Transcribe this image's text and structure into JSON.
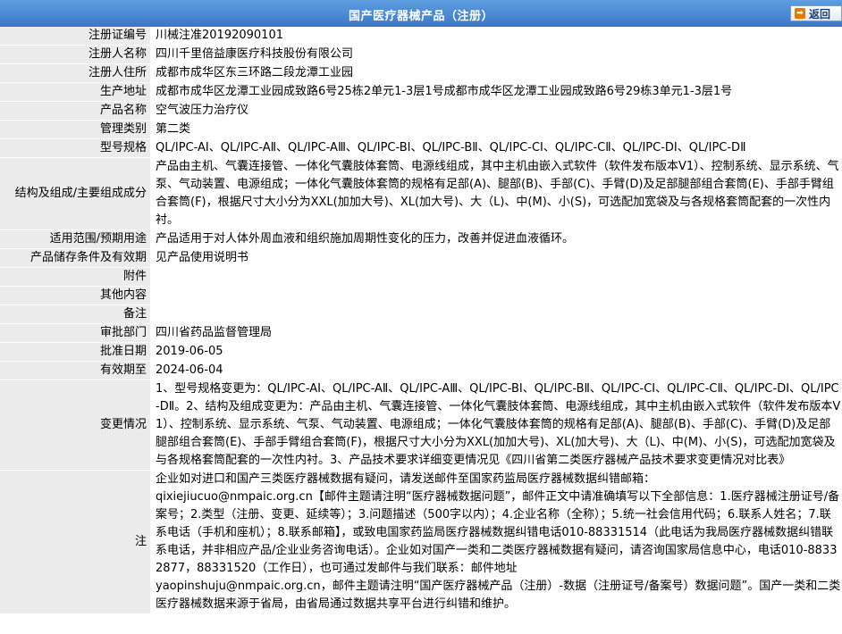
{
  "header": {
    "title": "国产医疗器械产品（注册）",
    "back_label": "返回"
  },
  "fields": {
    "reg_no": {
      "label": "注册证编号",
      "value": "川械注准20192090101"
    },
    "registrant": {
      "label": "注册人名称",
      "value": "四川千里倍益康医疗科技股份有限公司"
    },
    "address": {
      "label": "注册人住所",
      "value": "成都市成华区东三环路二段龙潭工业园"
    },
    "production": {
      "label": "生产地址",
      "value": "成都市成华区龙潭工业园成致路6号25栋2单元1-3层1号成都市成华区龙潭工业园成致路6号29栋3单元1-3层1号"
    },
    "product_name": {
      "label": "产品名称",
      "value": "空气波压力治疗仪"
    },
    "category": {
      "label": "管理类别",
      "value": "第二类"
    },
    "model": {
      "label": "型号规格",
      "value": "QL/IPC-AⅠ、QL/IPC-AⅡ、QL/IPC-AⅢ、QL/IPC-BⅠ、QL/IPC-BⅡ、QL/IPC-CⅠ、QL/IPC-CⅡ、QL/IPC-DⅠ、QL/IPC-DⅡ"
    },
    "structure": {
      "label": "结构及组成/主要组成成分",
      "value": "产品由主机、气囊连接管、一体化气囊肢体套筒、电源线组成，其中主机由嵌入式软件（软件发布版本V1）、控制系统、显示系统、气泵、气动装置、电源组成；一体化气囊肢体套筒的规格有足部(A)、腿部(B)、手部(C)、手臂(D)及足部腿部组合套筒(E)、手部手臂组合套筒(F)，根据尺寸大小分为XXL(加加大号)、XL(加大号)、大（L)、中(M)、小(S)，可选配加宽袋及与各规格套筒配套的一次性内衬。"
    },
    "scope": {
      "label": "适用范围/预期用途",
      "value": "产品适用于对人体外周血液和组织施加周期性变化的压力，改善并促进血液循环。"
    },
    "storage": {
      "label": "产品储存条件及有效期",
      "value": "见产品使用说明书"
    },
    "attachment": {
      "label": "附件",
      "value": ""
    },
    "other": {
      "label": "其他内容",
      "value": ""
    },
    "remarks": {
      "label": "备注",
      "value": ""
    },
    "dept": {
      "label": "审批部门",
      "value": "四川省药品监督管理局"
    },
    "approve_date": {
      "label": "批准日期",
      "value": "2019-06-05"
    },
    "expire_date": {
      "label": "有效期至",
      "value": "2024-06-04"
    },
    "changes": {
      "label": "变更情况",
      "value": "1、型号规格变更为：QL/IPC-AⅠ、QL/IPC-AⅡ、QL/IPC-AⅢ、QL/IPC-BⅠ、QL/IPC-BⅡ、QL/IPC-CⅠ、QL/IPC-CⅡ、QL/IPC-DⅠ、QL/IPC-DⅡ。2、结构及组成变更为：产品由主机、气囊连接管、一体化气囊肢体套筒、电源线组成，其中主机由嵌入式软件（软件发布版本V1）、控制系统、显示系统、气泵、气动装置、电源组成；一体化气囊肢体套筒的规格有足部(A)、腿部(B)、手部(C)、手臂(D)及足部腿部组合套筒(E)、手部手臂组合套筒(F)，根据尺寸大小分为XXL(加加大号)、XL(加大号)、大（L)、中(M)、小(S)，可选配加宽袋及与各规格套筒配套的一次性内衬。3、产品技术要求详细变更情况见《四川省第二类医疗器械产品技术要求变更情况对比表》"
    }
  },
  "note": {
    "label": "注",
    "part1": "企业如对进口和国产三类医疗器械数据有疑问，请发送邮件至国家药监局医疗器械数据纠错邮箱：",
    "email1": "qixiejiucuo@nmpaic.org.cn",
    "part2": "【邮件主题请注明“医疗器械数据问题”，邮件正文中请准确填写以下全部信息：1.医疗器械注册证号/备案号；2.类型（注册、变更、延续等）；3.问题描述（500字以内）；4.企业名称（全称）；5.统一社会信用代码；6.联系人姓名；7.联系电话（手机和座机）；8.联系邮箱】，或致电国家药监局医疗器械数据纠错电话010-88331514（此电话为我局医疗器械数据纠错联系电话，并非相应产品/企业业务咨询电话）。企业如对国产一类和二类医疗器械数据有疑问，请咨询国家局信息中心，电话010-88332877，88331520（工作日），也可通过发邮件与我们联系：邮件地址",
    "email2": "yaopinshuju@nmpaic.org.cn",
    "part3": "，邮件主题请注明“国产医疗器械产品（注册）-数据（注册证号/备案号）数据问题”。国产一类和二类医疗器械数据来源于省局，由省局通过数据共享平台进行纠错和维护。"
  }
}
